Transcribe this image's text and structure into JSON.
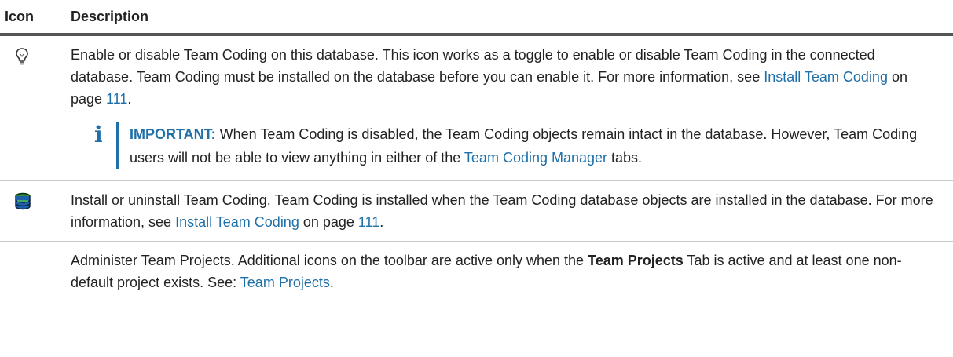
{
  "header": {
    "icon": "Icon",
    "description": "Description"
  },
  "rows": [
    {
      "icon": "lightbulb-icon",
      "text1": "Enable or disable Team Coding on this database. This icon works as a toggle to enable or disable Team Coding in the connected database. Team Coding must be installed on the database before you can enable it. For more information, see ",
      "link1": "Install Team Coding",
      "text2": " on page ",
      "link2": "111",
      "text3": ".",
      "note": {
        "icon": "info-icon",
        "label": "IMPORTANT:",
        "text1": " When Team Coding is disabled, the Team Coding objects remain intact in the database. However, Team Coding users will not be able to view anything in either of the ",
        "link": "Team Coding Manager",
        "text2": " tabs."
      }
    },
    {
      "icon": "database-icon",
      "text1": "Install or uninstall Team Coding. Team Coding is installed when the Team Coding database objects are installed in the database. For more information, see ",
      "link1": "Install Team Coding",
      "text2": " on page ",
      "link2": "111",
      "text3": "."
    },
    {
      "text1": "Administer Team Projects. Additional icons on the toolbar are active only when the ",
      "bold": "Team Projects",
      "text2": " Tab is active and at least one non-default project exists. See: ",
      "link": "Team Projects",
      "text3": "."
    }
  ]
}
